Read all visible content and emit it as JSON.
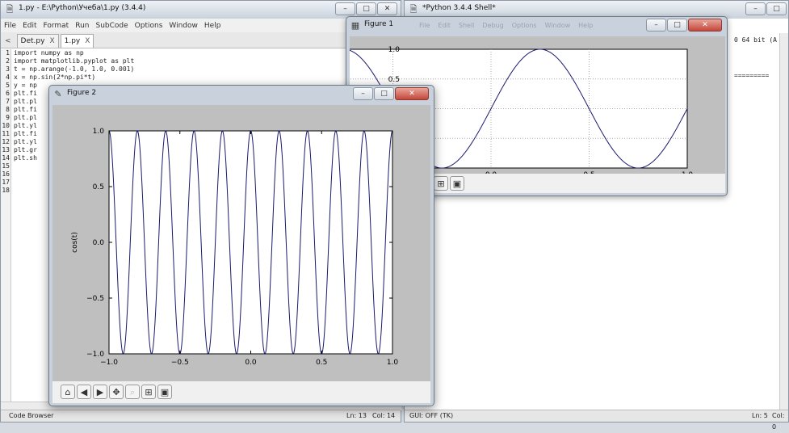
{
  "editor": {
    "title": "1.py - E:\\Python\\Учеба\\1.py (3.4.4)",
    "menu": [
      "File",
      "Edit",
      "Format",
      "Run",
      "SubCode",
      "Options",
      "Window",
      "Help"
    ],
    "tab_scroll": "<",
    "tabs": [
      {
        "label": "Det.py",
        "close": "X"
      },
      {
        "label": "1.py",
        "close": "X"
      }
    ],
    "line_numbers": [
      "1",
      "2",
      "3",
      "4",
      "5",
      "6",
      "7",
      "8",
      "9",
      "10",
      "11",
      "12",
      "13",
      "14",
      "15",
      "16",
      "17",
      "18"
    ],
    "code_lines": [
      "import numpy as np",
      "import matplotlib.pyplot as plt",
      "t = np.arange(-1.0, 1.0, 0.001)",
      "x = np.sin(2*np.pi*t)",
      "y = np",
      "plt.fi",
      "plt.pl",
      "plt.fi",
      "plt.pl",
      "plt.yl",
      "plt.fi",
      "plt.yl",
      "plt.gr",
      "plt.sh"
    ],
    "status_left": "Code Browser",
    "status_ln": "Ln: 13",
    "status_col": "Col: 14"
  },
  "shell": {
    "title": "*Python 3.4.4 Shell*",
    "text_fragment": "0 64 bit (A",
    "separator": "=========",
    "status_left": "GUI: OFF (TK)",
    "status_ln": "Ln: 5",
    "status_col": "Col: 0"
  },
  "figure1": {
    "title": "Figure 1",
    "background_menu": [
      "File",
      "Edit",
      "Shell",
      "Debug",
      "Options",
      "Window",
      "Help"
    ],
    "chart_data": {
      "type": "line",
      "title": "",
      "xlabel": "",
      "ylabel": "",
      "x_visible_ticks": [
        "−0.5",
        "0.0",
        "0.5",
        "1.0"
      ],
      "y_visible_ticks": [
        "1.0",
        "0.5"
      ],
      "xlim": [
        -1.0,
        1.0
      ],
      "ylim": [
        -1.0,
        1.0
      ],
      "grid": true,
      "series": [
        {
          "function": "sin(2πt)",
          "t_start": -1.0,
          "t_end": 1.0,
          "t_step": 0.001,
          "color": "#1a1a6e"
        }
      ]
    }
  },
  "figure2": {
    "title": "Figure 2",
    "chart_data": {
      "type": "line",
      "title": "",
      "xlabel": "",
      "ylabel": "cos(t)",
      "x_ticks": [
        "−1.0",
        "−0.5",
        "0.0",
        "0.5",
        "1.0"
      ],
      "y_ticks": [
        "1.0",
        "0.5",
        "0.0",
        "−0.5",
        "−1.0"
      ],
      "xlim": [
        -1.0,
        1.0
      ],
      "ylim": [
        -1.0,
        1.0
      ],
      "grid": false,
      "series": [
        {
          "function": "cos(5·2πt)",
          "t_start": -1.0,
          "t_end": 1.0,
          "t_step": 0.001,
          "color": "#1a1a6e"
        }
      ]
    }
  },
  "toolbar_icons": [
    "home-icon",
    "back-icon",
    "forward-icon",
    "pan-icon",
    "zoom-icon",
    "configure-subplots-icon",
    "save-icon"
  ],
  "colors": {
    "plot_bg": "#ffffff",
    "figure_bg": "#bfbfbf",
    "line": "#1a1a6e"
  }
}
